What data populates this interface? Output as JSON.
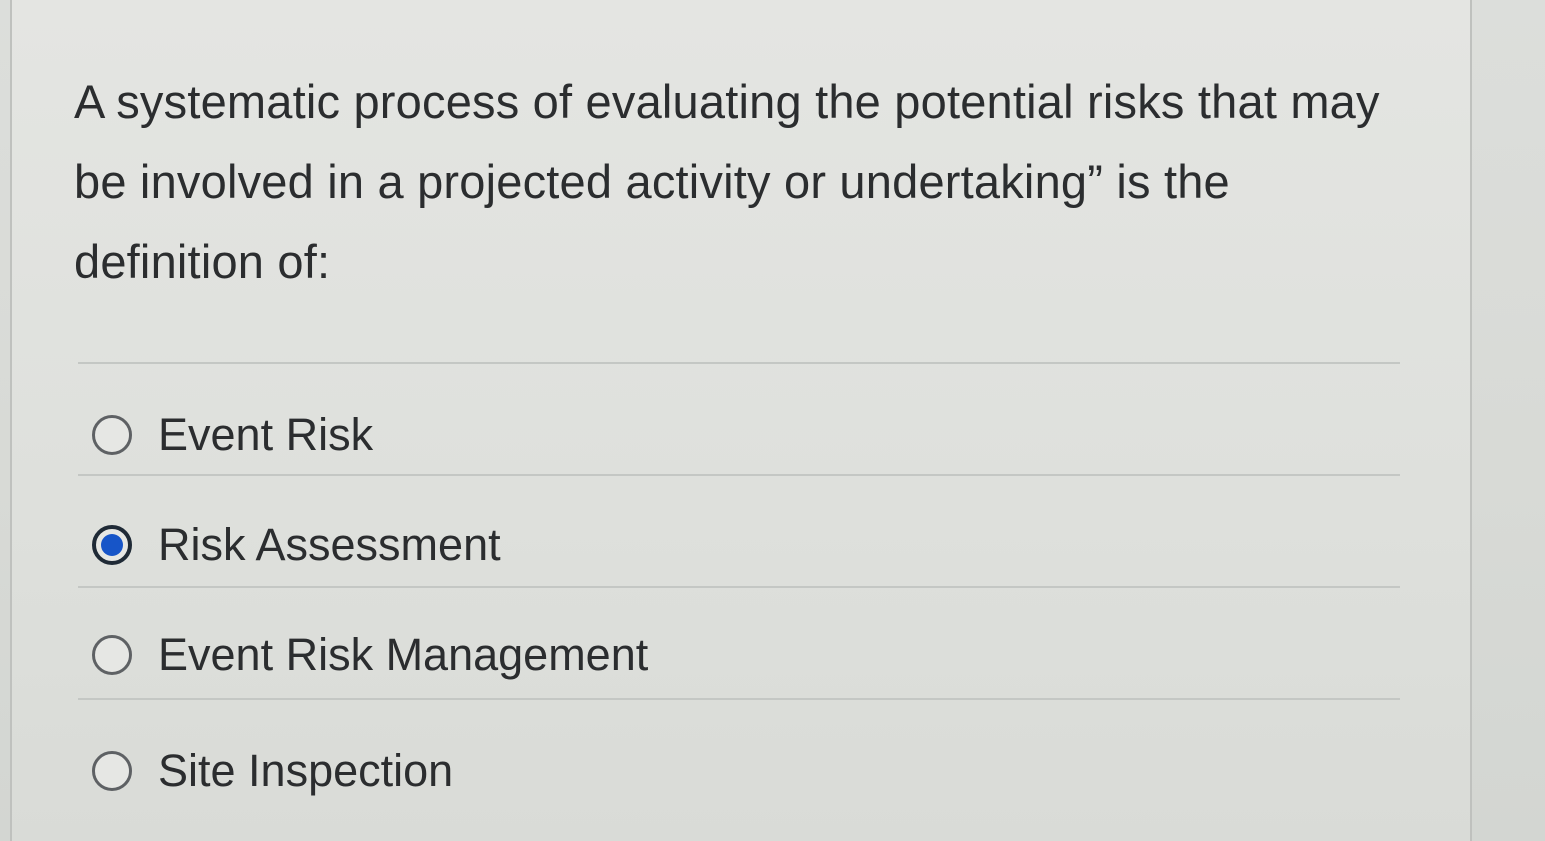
{
  "question": {
    "text": "A systematic process of evaluating the potential risks that may be involved in a projected activity or undertaking” is the definition of:"
  },
  "options": [
    {
      "label": "Event Risk",
      "selected": false
    },
    {
      "label": "Risk Assessment",
      "selected": true
    },
    {
      "label": "Event Risk Management",
      "selected": false
    },
    {
      "label": "Site Inspection",
      "selected": false
    }
  ],
  "colors": {
    "selected_radio": "#1755c8",
    "text": "#2b2d2f"
  }
}
